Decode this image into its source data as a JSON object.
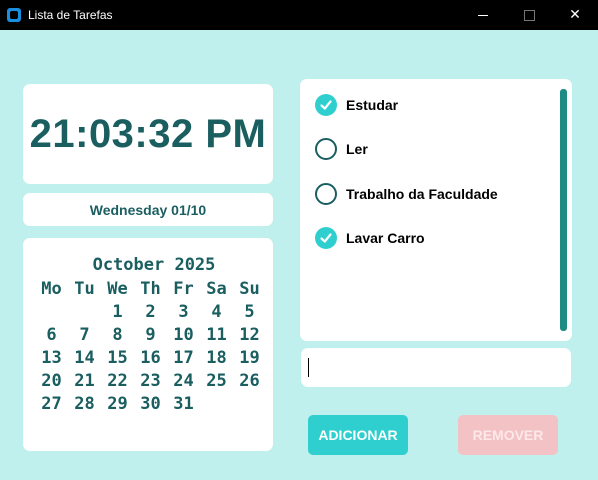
{
  "window": {
    "title": "Lista de Tarefas",
    "minimize": "—",
    "maximize": "☐",
    "close": "✕"
  },
  "clock": {
    "time": "21:03:32 PM"
  },
  "date": {
    "text": "Wednesday 01/10"
  },
  "calendar": {
    "title": "October 2025",
    "weekdays": [
      "Mo",
      "Tu",
      "We",
      "Th",
      "Fr",
      "Sa",
      "Su"
    ],
    "weeks": [
      [
        "",
        "",
        "1",
        "2",
        "3",
        "4",
        "5"
      ],
      [
        "6",
        "7",
        "8",
        "9",
        "10",
        "11",
        "12"
      ],
      [
        "13",
        "14",
        "15",
        "16",
        "17",
        "18",
        "19"
      ],
      [
        "20",
        "21",
        "22",
        "23",
        "24",
        "25",
        "26"
      ],
      [
        "27",
        "28",
        "29",
        "30",
        "31",
        "",
        ""
      ]
    ]
  },
  "tasks": [
    {
      "label": "Estudar",
      "done": true
    },
    {
      "label": "Ler",
      "done": false
    },
    {
      "label": "Trabalho da Faculdade",
      "done": false
    },
    {
      "label": "Lavar Carro",
      "done": true
    }
  ],
  "input": {
    "value": "",
    "placeholder": ""
  },
  "buttons": {
    "add": "ADICIONAR",
    "remove": "REMOVER"
  },
  "colors": {
    "accent": "#2fcfcf",
    "text_dark": "#1a5e60",
    "background": "#c0f0ee",
    "remove_disabled": "#f3c2c4"
  }
}
